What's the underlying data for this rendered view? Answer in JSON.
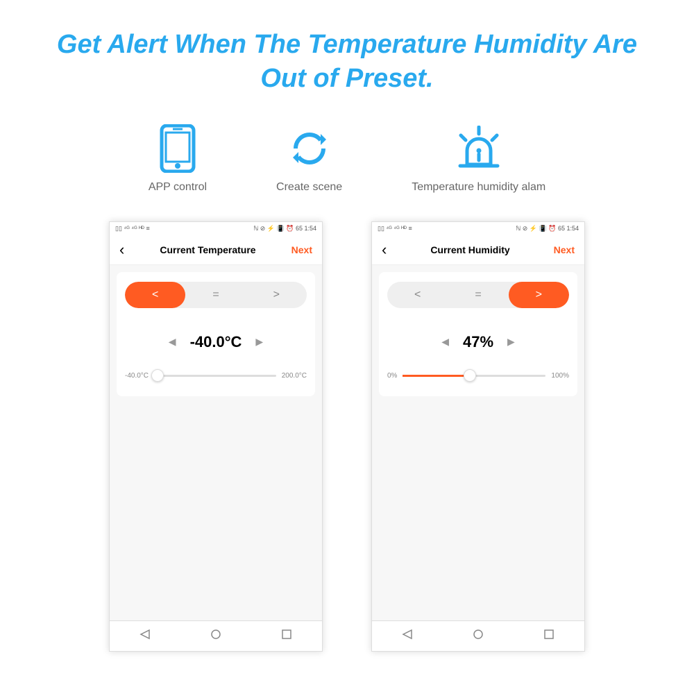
{
  "headline": "Get Alert When The Temperature Humidity Are Out of Preset.",
  "features": [
    {
      "label": "APP control"
    },
    {
      "label": "Create scene"
    },
    {
      "label": "Temperature humidity alam"
    }
  ],
  "status": {
    "left": "▯▯ ⁴ᴳ ⁴ᴳ ᴴᴰ ≡",
    "right": "ℕ ⊘ ⚡ 📳 ⏰ 65 1:54"
  },
  "phones": {
    "temp": {
      "title": "Current Temperature",
      "next": "Next",
      "seg": {
        "lt": "<",
        "eq": "=",
        "gt": ">",
        "active": "lt"
      },
      "value": "-40.0°C",
      "min": "-40.0°C",
      "max": "200.0°C",
      "slider_percent": 0
    },
    "hum": {
      "title": "Current Humidity",
      "next": "Next",
      "seg": {
        "lt": "<",
        "eq": "=",
        "gt": ">",
        "active": "gt"
      },
      "value": "47%",
      "min": "0%",
      "max": "100%",
      "slider_percent": 47
    }
  }
}
